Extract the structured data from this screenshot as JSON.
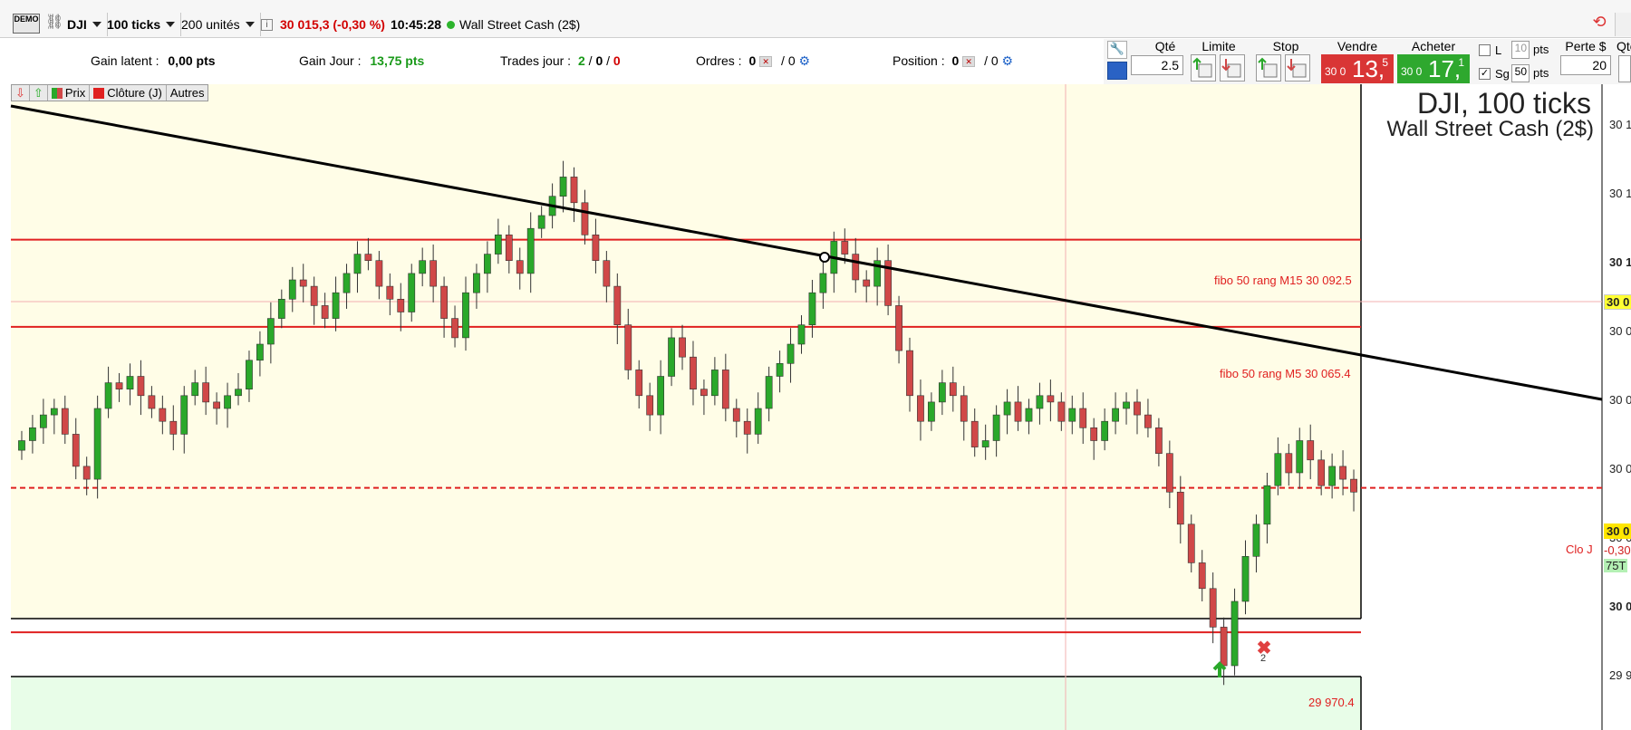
{
  "toolbar": {
    "demo_label": "DEMO",
    "instrument": "DJI",
    "period": "100 ticks",
    "units": "200 unités",
    "quote": "30 015,3 (-0,30 %)",
    "time": "10:45:28",
    "market": "Wall Street Cash (2$)"
  },
  "stats": {
    "gain_latent_label": "Gain latent :",
    "gain_latent_value": "0,00 pts",
    "gain_jour_label": "Gain Jour :",
    "gain_jour_value": "13,75 pts",
    "trades_label": "Trades jour :",
    "trades_a": "2",
    "trades_sep1": "/",
    "trades_b": "0",
    "trades_sep2": "/",
    "trades_c": "0",
    "ordres_label": "Ordres :",
    "ordres_a": "0",
    "ordres_b": "/ 0",
    "position_label": "Position :",
    "position_a": "0",
    "position_b": "/ 0"
  },
  "order_panel": {
    "qty_label": "Qté",
    "qty_value": "2.5",
    "limite_label": "Limite",
    "stop_label": "Stop",
    "vendre_label": "Vendre",
    "acheter_label": "Acheter",
    "sell_small": "30 0",
    "sell_big": "13,",
    "sell_frac": "5",
    "buy_small": "30 0",
    "buy_big": "17,",
    "buy_frac": "1",
    "l_label": "L",
    "l_value": "10",
    "pts1": "pts",
    "sg_label": "Sg",
    "sg_value": "50",
    "pts2": "pts",
    "perte_label": "Perte $",
    "perte_value": "20",
    "qte2_label": "Qte"
  },
  "legend": {
    "prix": "Prix",
    "cloture": "Clôture (J)",
    "autres": "Autres"
  },
  "chart_title": "DJI, 100 ticks",
  "chart_subtitle": "Wall Street Cash (2$)",
  "annotations": {
    "fibo_m15": "fibo 50 rang M15 30 092.5",
    "fibo_m5": "fibo 50 rang M5 30 065.4",
    "level_low": "29 970.4",
    "clo_j": "Clo J",
    "trade_count": "2"
  },
  "axis": {
    "labels": [
      "30 1",
      "30 1",
      "30 1",
      "30 0",
      "30 0",
      "30 0",
      "30 0",
      "30 0",
      "29 9"
    ],
    "current_price_tag": "30 0",
    "last_price_tag": "30 0",
    "change_tag": "-0,30",
    "ticks_tag": "75T"
  },
  "colors": {
    "bull": "#2aa82a",
    "bear": "#d04848",
    "zone_yellow": "#fffde7",
    "zone_green": "#e8fde8",
    "fibo_line": "#e02020",
    "trend_line": "#000000"
  },
  "chart_data": {
    "type": "candlestick",
    "title": "DJI, 100 ticks",
    "series_close": [
      30030,
      30034,
      30038,
      30040,
      30032,
      30022,
      30018,
      30040,
      30048,
      30046,
      30050,
      30044,
      30040,
      30036,
      30032,
      30044,
      30048,
      30042,
      30040,
      30044,
      30046,
      30055,
      30060,
      30068,
      30074,
      30080,
      30078,
      30072,
      30068,
      30076,
      30082,
      30088,
      30086,
      30078,
      30074,
      30070,
      30082,
      30086,
      30078,
      30068,
      30062,
      30076,
      30082,
      30088,
      30094,
      30086,
      30082,
      30096,
      30100,
      30106,
      30112,
      30104,
      30094,
      30086,
      30078,
      30066,
      30052,
      30044,
      30038,
      30050,
      30062,
      30056,
      30046,
      30044,
      30052,
      30040,
      30036,
      30032,
      30040,
      30050,
      30054,
      30060,
      30066,
      30076,
      30082,
      30092,
      30088,
      30080,
      30078,
      30086,
      30072,
      30058,
      30044,
      30036,
      30042,
      30048,
      30044,
      30036,
      30028,
      30030,
      30038,
      30042,
      30036,
      30040,
      30044,
      30042,
      30036,
      30040,
      30034,
      30030,
      30036,
      30040,
      30042,
      30038,
      30034,
      30026,
      30014,
      30004,
      29992,
      29984,
      29972,
      29960,
      29980,
      29994,
      30004,
      30016,
      30026,
      30020,
      30030,
      30024,
      30016,
      30022,
      30018,
      30014
    ],
    "ylim": [
      29940,
      30140
    ],
    "reference_lines": [
      {
        "label": "fibo 50 rang M15 30 092.5",
        "value": 30092.5
      },
      {
        "label": "fibo 50 rang M5 30 065.4",
        "value": 30065.4
      },
      {
        "label": "29 970.4",
        "value": 29970.4
      },
      {
        "label": "Clo J",
        "value": 30015.3
      }
    ]
  }
}
